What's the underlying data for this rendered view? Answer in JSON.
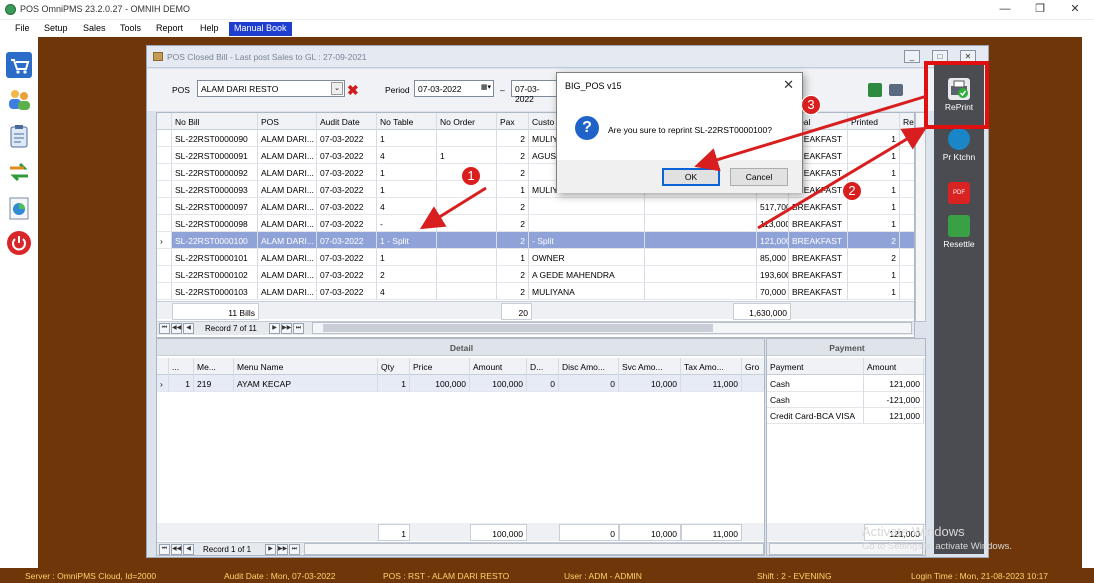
{
  "app": {
    "title": "POS OmniPMS 23.2.0.27 - OMNIH DEMO",
    "window_controls": [
      "—",
      "❐",
      "✕"
    ]
  },
  "menu": {
    "items": [
      "File",
      "Setup",
      "Sales",
      "Tools",
      "Report",
      "Help",
      "Manual Book"
    ],
    "active": "Manual Book"
  },
  "left_toolbar": {
    "icons": [
      "cart-icon",
      "users-icon",
      "clipboard-icon",
      "exchange-icon",
      "chart-icon",
      "power-icon"
    ]
  },
  "window": {
    "title": "POS Closed Bill - Last post Sales to GL : 27-09-2021",
    "controls": [
      "_",
      "□",
      "✕"
    ]
  },
  "filter": {
    "pos_label": "POS",
    "pos_value": "ALAM DARI RESTO",
    "period_label": "Period",
    "period_from": "07-03-2022",
    "period_sep": "–",
    "period_to": "07-03-2022"
  },
  "bills": {
    "columns": [
      "No Bill",
      "POS",
      "Audit Date",
      "No Table",
      "No Order",
      "Pax",
      "Custo",
      "",
      "",
      "Meal",
      "Printed",
      "Re"
    ],
    "rows": [
      [
        "SL-22RST0000090",
        "ALAM DARI...",
        "07-03-2022",
        "1",
        "",
        "2",
        "MULIY",
        "",
        "",
        "BREAKFAST",
        "1",
        ""
      ],
      [
        "SL-22RST0000091",
        "ALAM DARI...",
        "07-03-2022",
        "4",
        "1",
        "2",
        "AGUS",
        "",
        "",
        "BREAKFAST",
        "1",
        ""
      ],
      [
        "SL-22RST0000092",
        "ALAM DARI...",
        "07-03-2022",
        "1",
        "",
        "2",
        "",
        "",
        "",
        "BREAKFAST",
        "1",
        ""
      ],
      [
        "SL-22RST0000093",
        "ALAM DARI...",
        "07-03-2022",
        "1",
        "",
        "1",
        "MULIY",
        "",
        "",
        "BREAKFAST",
        "1",
        ""
      ],
      [
        "SL-22RST0000097",
        "ALAM DARI...",
        "07-03-2022",
        "4",
        "",
        "2",
        "",
        "",
        "517,700",
        "BREAKFAST",
        "1",
        ""
      ],
      [
        "SL-22RST0000098",
        "ALAM DARI...",
        "07-03-2022",
        "-",
        "",
        "2",
        "",
        "",
        "113,000",
        "BREAKFAST",
        "1",
        ""
      ],
      [
        "SL-22RST0000100",
        "ALAM DARI...",
        "07-03-2022",
        "1 - Split",
        "",
        "2",
        " - Split",
        "",
        "121,000",
        "BREAKFAST",
        "2",
        ""
      ],
      [
        "SL-22RST0000101",
        "ALAM DARI...",
        "07-03-2022",
        "1",
        "",
        "1",
        "OWNER",
        "",
        "85,000",
        "BREAKFAST",
        "2",
        ""
      ],
      [
        "SL-22RST0000102",
        "ALAM DARI...",
        "07-03-2022",
        "2",
        "",
        "2",
        "A GEDE MAHENDRA",
        "",
        "193,600",
        "BREAKFAST",
        "1",
        ""
      ],
      [
        "SL-22RST0000103",
        "ALAM DARI...",
        "07-03-2022",
        "4",
        "",
        "2",
        "MULIYANA",
        "",
        "70,000",
        "BREAKFAST",
        "1",
        ""
      ]
    ],
    "selected_index": 6,
    "footer": {
      "count": "11 Bills",
      "pax": "20",
      "total": "1,630,000"
    },
    "nav_text": "Record 7 of 11"
  },
  "detail": {
    "title": "Detail",
    "columns": [
      "...",
      "Me...",
      "Menu Name",
      "Qty",
      "Price",
      "Amount",
      "D...",
      "Disc Amo...",
      "Svc Amo...",
      "Tax Amo...",
      "Gro"
    ],
    "rows": [
      [
        "1",
        "219",
        "AYAM KECAP",
        "1",
        "100,000",
        "100,000",
        "0",
        "0",
        "10,000",
        "11,000",
        ""
      ]
    ],
    "footer": [
      "",
      "",
      "",
      "1",
      "",
      "100,000",
      "",
      "0",
      "10,000",
      "11,000",
      ""
    ],
    "nav_text": "Record 1 of 1"
  },
  "payment": {
    "title": "Payment",
    "columns": [
      "Payment",
      "Amount"
    ],
    "rows": [
      [
        "Cash",
        "121,000"
      ],
      [
        "Cash",
        "-121,000"
      ],
      [
        "Credit Card-BCA VISA",
        "121,000"
      ]
    ],
    "footer_total": "121,000"
  },
  "side_panel": {
    "buttons": [
      {
        "label": "RePrint",
        "icon": "printer-check-icon"
      },
      {
        "label": "Pr Ktchn",
        "icon": "kitchen-printer-icon"
      },
      {
        "label": "",
        "icon": "pdf-icon"
      },
      {
        "label": "Resettle",
        "icon": "money-icon"
      }
    ]
  },
  "dialog": {
    "title": "BIG_POS v15",
    "message": "Are you sure to reprint SL-22RST0000100?",
    "ok_label": "OK",
    "cancel_label": "Cancel"
  },
  "annotations": [
    "1",
    "2",
    "3"
  ],
  "watermark": {
    "line1": "Activate Windows",
    "line2": "Go to Settings to activate Windows."
  },
  "status_bar": {
    "server": "Server : OmniPMS Cloud, Id=2000",
    "audit_date": "Audit Date : Mon, 07-03-2022",
    "pos": "POS : RST - ALAM DARI RESTO",
    "user": "User : ADM - ADMIN",
    "shift": "Shift : 2 - EVENING",
    "login": "Login Time : Mon, 21-08-2023 10:17"
  },
  "colors": {
    "desktop": "#6e3609",
    "selected_row": "#8fa3d8",
    "menu_active": "#1e3ed0",
    "annotation_red": "#d81e1e",
    "status_text": "#ffd36b"
  }
}
